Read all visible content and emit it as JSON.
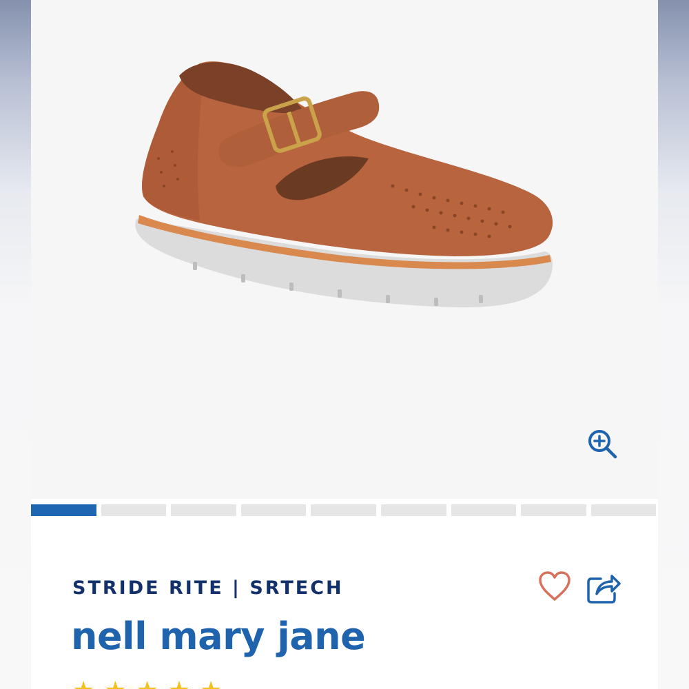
{
  "product": {
    "brand": "STRIDE RITE | SRTECH",
    "name": "nell mary jane",
    "rating_stars": 5
  },
  "gallery": {
    "image_count": 9,
    "active_index": 0,
    "image_description_icon": "shoe-image"
  },
  "icons": {
    "zoom": "zoom-in-icon",
    "favorite": "heart-icon",
    "share": "share-icon",
    "star": "star-icon"
  },
  "colors": {
    "brand_navy": "#12306a",
    "title_blue": "#1f63ad",
    "pager_active": "#1f66b2",
    "pager_inactive": "#e6e6e6",
    "heart": "#d6715c",
    "share": "#1f63ad",
    "star": "#f3c21a"
  }
}
